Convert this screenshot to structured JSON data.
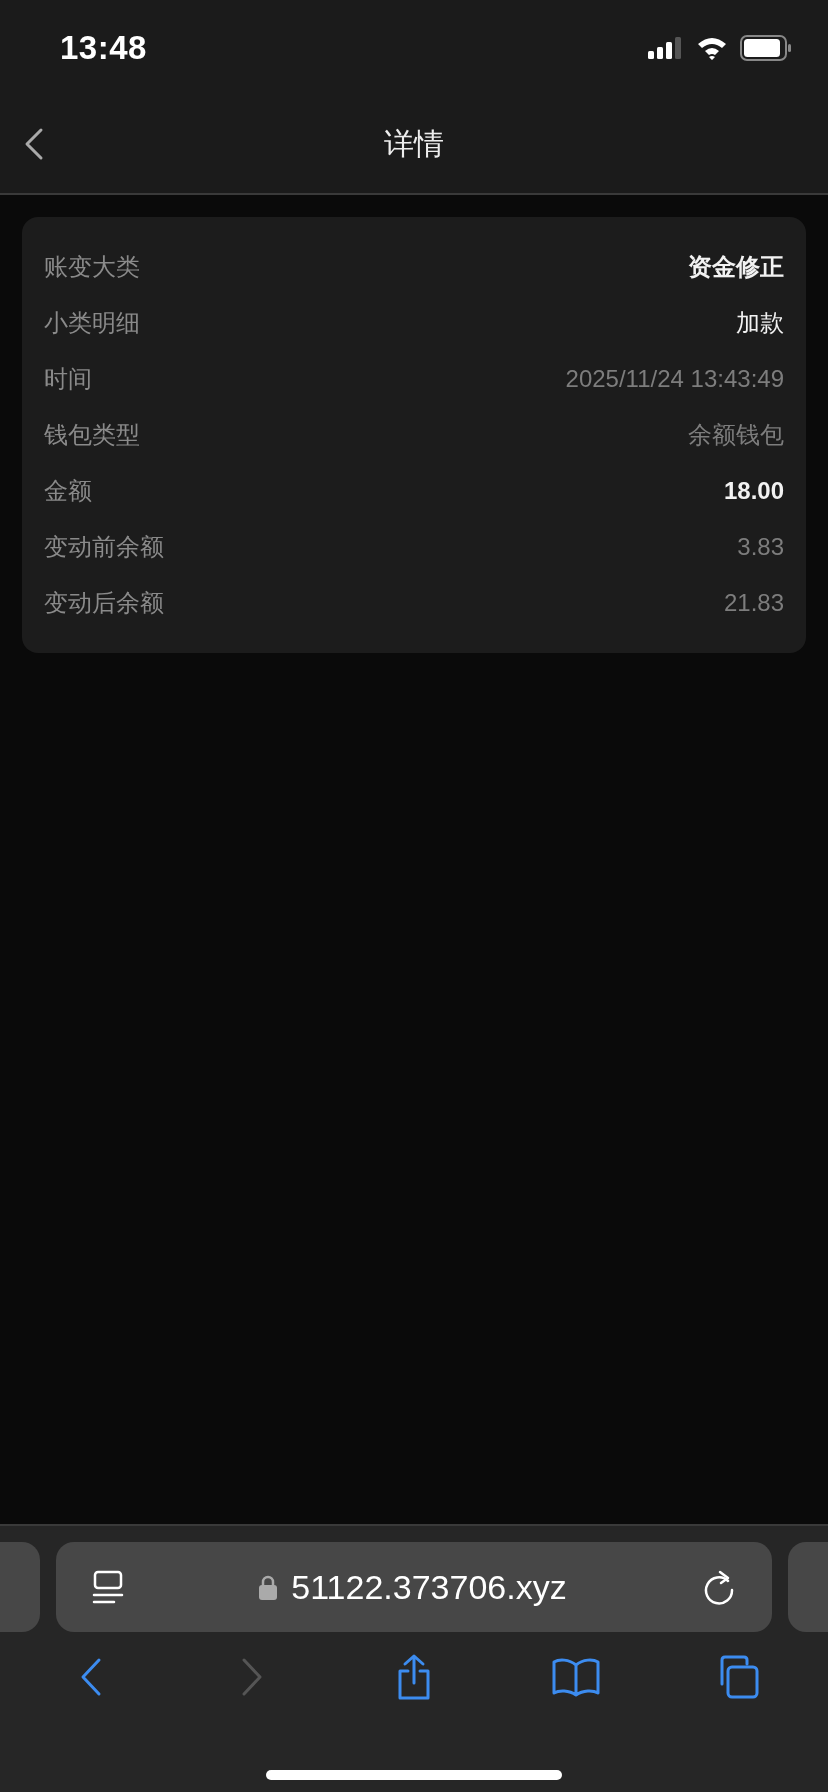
{
  "status_bar": {
    "time": "13:48"
  },
  "nav_bar": {
    "title": "详情"
  },
  "details": [
    {
      "label": "账变大类",
      "value": "资金修正",
      "kind": "bold"
    },
    {
      "label": "小类明细",
      "value": "加款",
      "kind": "plain"
    },
    {
      "label": "时间",
      "value": "2025/11/24 13:43:49",
      "kind": "muted"
    },
    {
      "label": "钱包类型",
      "value": "余额钱包",
      "kind": "muted"
    },
    {
      "label": "金额",
      "value": "18.00",
      "kind": "bold"
    },
    {
      "label": "变动前余额",
      "value": "3.83",
      "kind": "muted"
    },
    {
      "label": "变动后余额",
      "value": "21.83",
      "kind": "muted"
    }
  ],
  "browser": {
    "address": "51122.373706.xyz",
    "toolbar": [
      {
        "kind": "back",
        "disabled": false
      },
      {
        "kind": "forward",
        "disabled": true
      },
      {
        "kind": "share",
        "disabled": false
      },
      {
        "kind": "bookmarks",
        "disabled": false
      },
      {
        "kind": "tabs",
        "disabled": false
      }
    ]
  }
}
